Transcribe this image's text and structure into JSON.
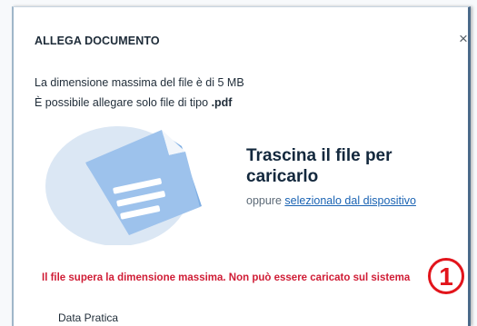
{
  "dialog": {
    "title": "ALLEGA DOCUMENTO",
    "close_symbol": "×",
    "max_size_text": "La dimensione massima del file è di 5 MB",
    "allowed_prefix": "È possibile allegare solo file di tipo ",
    "allowed_ext": ".pdf"
  },
  "dropzone": {
    "title": "Trascina il file per caricarlo",
    "or_text": "oppure ",
    "select_link": "selezionalo dal dispositivo",
    "icon": "document-icon"
  },
  "error": {
    "message": "Il file supera la dimensione massima. Non può essere caricato sul sistema",
    "color": "#d01d36"
  },
  "annotation": {
    "badge_number": "1",
    "badge_color": "#e2141b"
  },
  "form": {
    "next_field_label": "Data Pratica"
  }
}
